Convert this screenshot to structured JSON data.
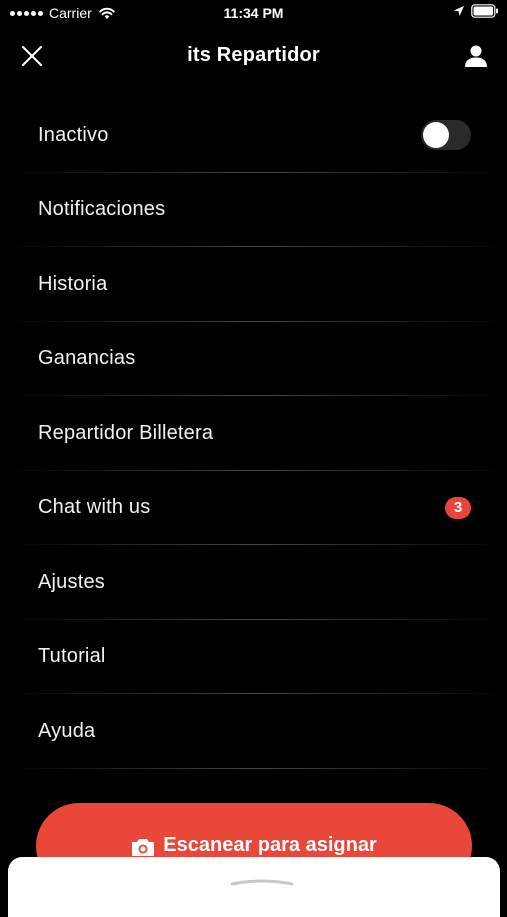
{
  "status_bar": {
    "carrier": "Carrier",
    "time": "11:34 PM"
  },
  "header": {
    "title": "its Repartidor"
  },
  "menu": {
    "items": [
      {
        "label": "Inactivo",
        "control": "toggle",
        "toggle_on": false
      },
      {
        "label": "Notificaciones"
      },
      {
        "label": "Historia"
      },
      {
        "label": "Ganancias"
      },
      {
        "label": "Repartidor Billetera"
      },
      {
        "label": "Chat with us",
        "badge": "3"
      },
      {
        "label": "Ajustes"
      },
      {
        "label": "Tutorial"
      },
      {
        "label": "Ayuda"
      }
    ]
  },
  "scan_button": {
    "label": "Escanear para asignar",
    "icon": "camera-icon"
  },
  "colors": {
    "background": "#000000",
    "accent": "#e8473a",
    "badge": "#e8453c",
    "toggle_track": "#2a2a2a"
  },
  "icons": {
    "close": "close-icon",
    "profile": "user-icon",
    "wifi": "wifi-icon",
    "location": "location-arrow-icon",
    "battery": "battery-icon"
  }
}
